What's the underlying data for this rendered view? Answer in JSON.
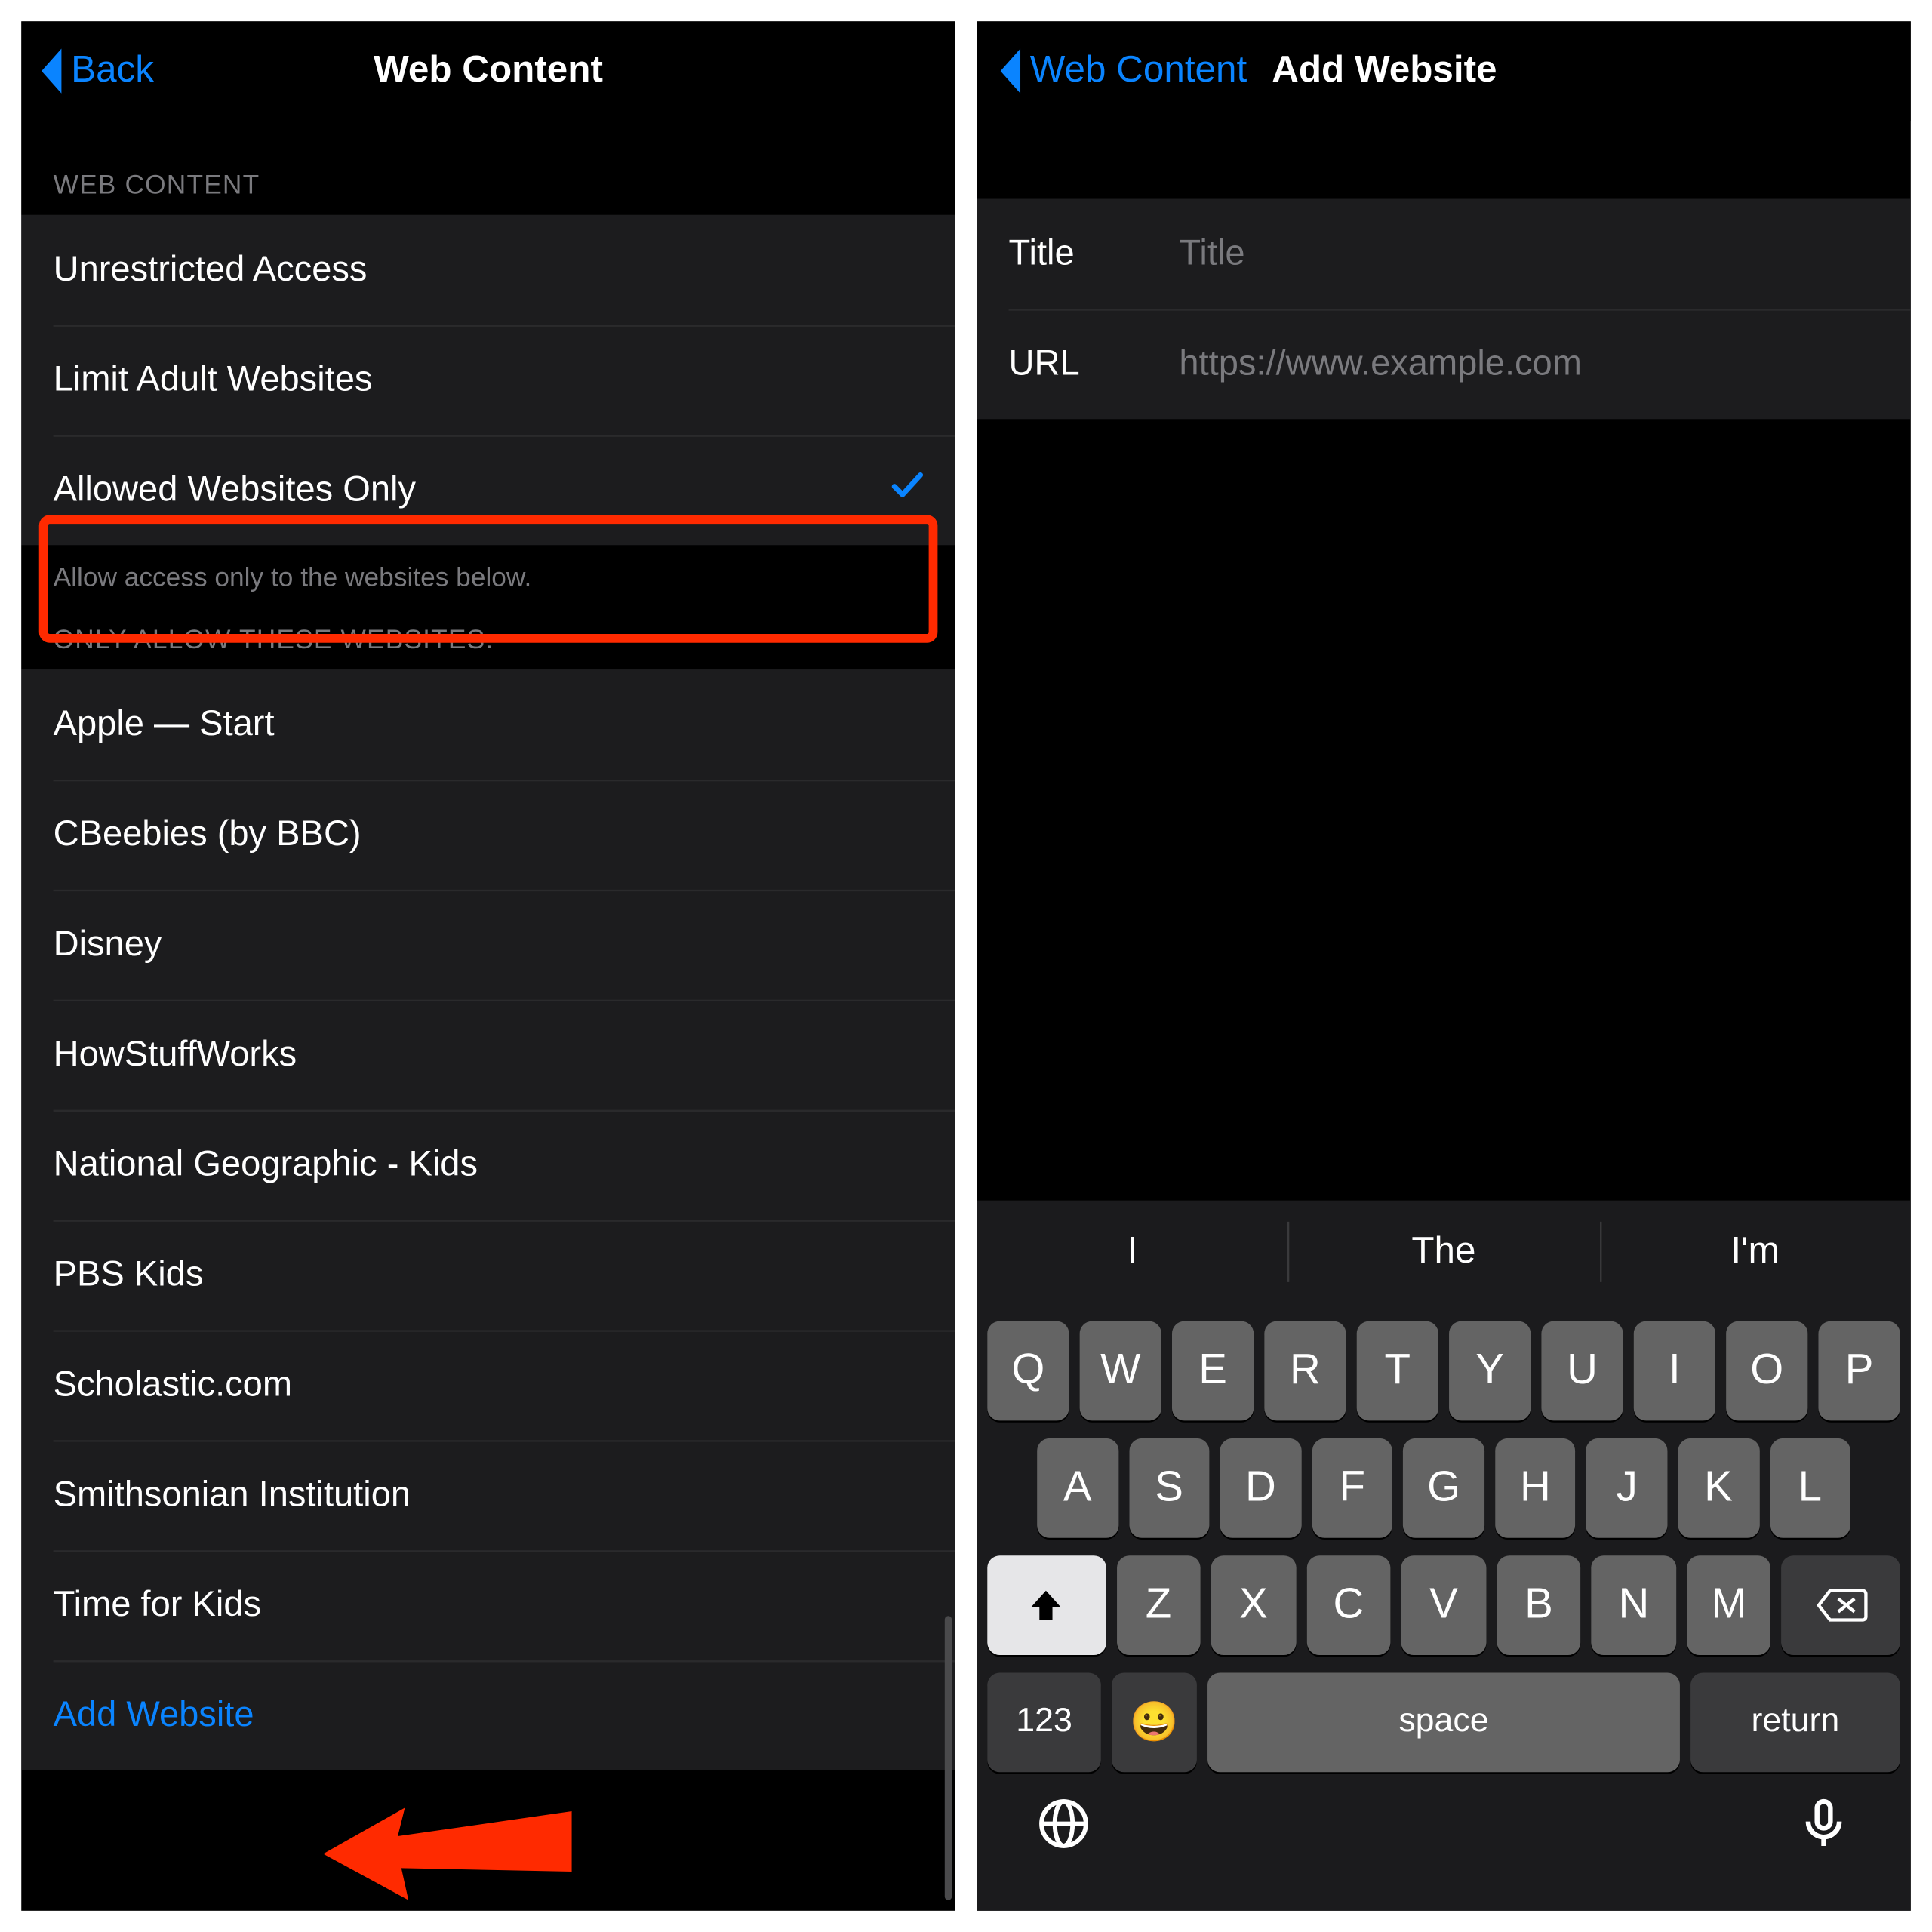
{
  "left": {
    "nav": {
      "back_label": "Back",
      "title": "Web Content"
    },
    "section_header": "WEB CONTENT",
    "options": [
      {
        "label": "Unrestricted Access",
        "selected": false
      },
      {
        "label": "Limit Adult Websites",
        "selected": false
      },
      {
        "label": "Allowed Websites Only",
        "selected": true
      }
    ],
    "section_footer": "Allow access only to the websites below.",
    "allow_header": "ONLY ALLOW THESE WEBSITES:",
    "sites": [
      "Apple — Start",
      "CBeebies (by BBC)",
      "Disney",
      "HowStuffWorks",
      "National Geographic - Kids",
      "PBS Kids",
      "Scholastic.com",
      "Smithsonian Institution",
      "Time for Kids"
    ],
    "add_label": "Add Website"
  },
  "right": {
    "nav": {
      "back_label": "Web Content",
      "title": "Add Website"
    },
    "fields": {
      "title_label": "Title",
      "title_placeholder": "Title",
      "url_label": "URL",
      "url_placeholder": "https://www.example.com"
    },
    "keyboard": {
      "suggestions": [
        "I",
        "The",
        "I'm"
      ],
      "rows": [
        [
          "Q",
          "W",
          "E",
          "R",
          "T",
          "Y",
          "U",
          "I",
          "O",
          "P"
        ],
        [
          "A",
          "S",
          "D",
          "F",
          "G",
          "H",
          "J",
          "K",
          "L"
        ],
        [
          "Z",
          "X",
          "C",
          "V",
          "B",
          "N",
          "M"
        ]
      ],
      "num_label": "123",
      "space_label": "space",
      "return_label": "return",
      "emoji": "😀"
    }
  },
  "colors": {
    "accent": "#0a84ff",
    "highlight": "#ff2a00"
  }
}
